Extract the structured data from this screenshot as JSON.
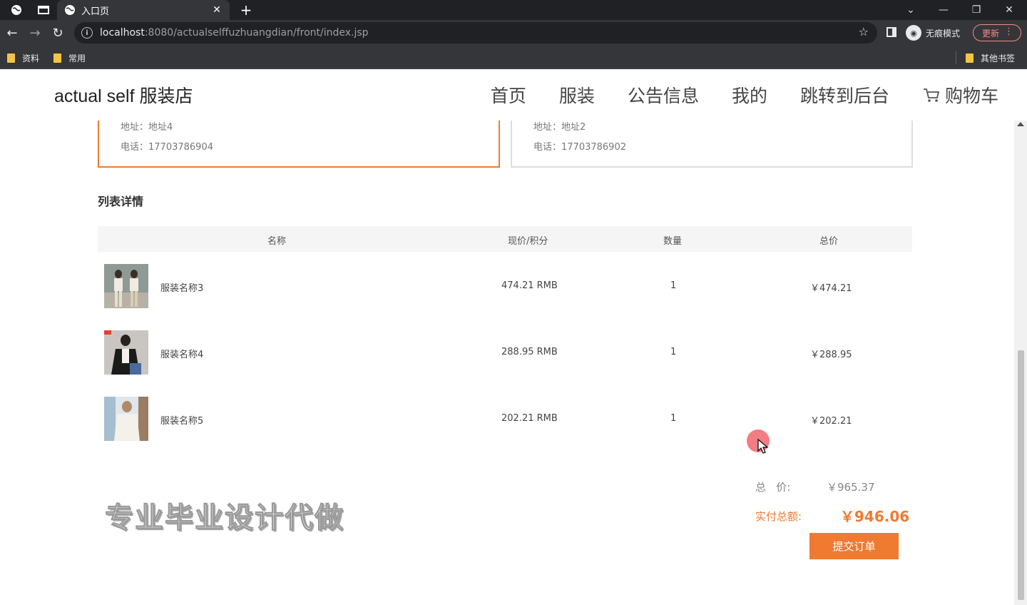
{
  "browser": {
    "tab_title": "入口页",
    "url_host": "localhost",
    "url_rest": ":8080/actualselffuzhuangdian/front/index.jsp",
    "incognito_label": "无痕模式",
    "update_label": "更新",
    "bookmarks": [
      "资料",
      "常用"
    ],
    "other_bookmarks": "其他书签"
  },
  "site": {
    "brand": "actual self 服装店",
    "nav": [
      "首页",
      "服装",
      "公告信息",
      "我的",
      "跳转到后台",
      "购物车"
    ]
  },
  "addresses": [
    {
      "address": "地址：地址4",
      "phone": "电话：17703786904",
      "selected": true
    },
    {
      "address": "地址：地址2",
      "phone": "电话：17703786902",
      "selected": false
    }
  ],
  "list": {
    "title": "列表详情",
    "headers": [
      "名称",
      "现价/积分",
      "数量",
      "总价"
    ],
    "rows": [
      {
        "name": "服装名称3",
        "price": "474.21 RMB",
        "qty": "1",
        "total": "￥474.21"
      },
      {
        "name": "服装名称4",
        "price": "288.95 RMB",
        "qty": "1",
        "total": "￥288.95"
      },
      {
        "name": "服装名称5",
        "price": "202.21 RMB",
        "qty": "1",
        "total": "￥202.21"
      }
    ]
  },
  "summary": {
    "total_label": "总   价:",
    "total_value": "￥965.37",
    "paid_label": "实付总额:",
    "paid_value": "￥946.06",
    "submit_label": "提交订单"
  },
  "watermark": "专业毕业设计代做",
  "colors": {
    "accent": "#ef7a30",
    "chrome_dark": "#202124",
    "chrome_mid": "#35363a"
  }
}
